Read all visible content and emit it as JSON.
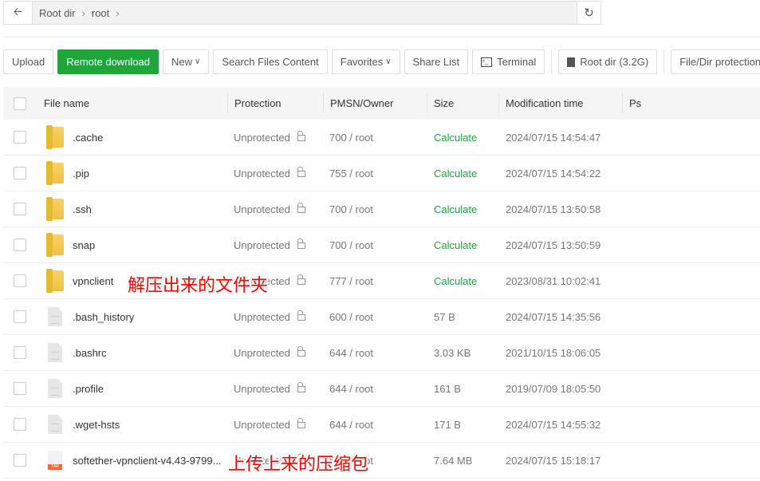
{
  "address": {
    "crumbs": [
      "Root dir",
      "root"
    ]
  },
  "toolbar": {
    "upload": "Upload",
    "remote_download": "Remote download",
    "new": "New",
    "search": "Search Files Content",
    "favorites": "Favorites",
    "share": "Share List",
    "terminal": "Terminal",
    "rootdir": "Root dir (3.2G)",
    "protection": "File/Dir protection"
  },
  "headers": {
    "name": "File name",
    "protection": "Protection",
    "pmsn": "PMSN/Owner",
    "size": "Size",
    "mtime": "Modification time",
    "ps": "Ps"
  },
  "rows": [
    {
      "type": "folder",
      "name": ".cache",
      "prot": "Unprotected",
      "pmsn": "700 / root",
      "size": "Calculate",
      "mtime": "2024/07/15 14:54:47"
    },
    {
      "type": "folder",
      "name": ".pip",
      "prot": "Unprotected",
      "pmsn": "755 / root",
      "size": "Calculate",
      "mtime": "2024/07/15 14:54:22"
    },
    {
      "type": "folder",
      "name": ".ssh",
      "prot": "Unprotected",
      "pmsn": "700 / root",
      "size": "Calculate",
      "mtime": "2024/07/15 13:50:58"
    },
    {
      "type": "folder",
      "name": "snap",
      "prot": "Unprotected",
      "pmsn": "700 / root",
      "size": "Calculate",
      "mtime": "2024/07/15 13:50:59"
    },
    {
      "type": "folder",
      "name": "vpnclient",
      "prot": "Unprotected",
      "pmsn": "777 / root",
      "size": "Calculate",
      "mtime": "2023/08/31 10:02:41"
    },
    {
      "type": "file",
      "name": ".bash_history",
      "prot": "Unprotected",
      "pmsn": "600 / root",
      "size": "57 B",
      "mtime": "2024/07/15 14:35:56"
    },
    {
      "type": "file",
      "name": ".bashrc",
      "prot": "Unprotected",
      "pmsn": "644 / root",
      "size": "3.03 KB",
      "mtime": "2021/10/15 18:06:05"
    },
    {
      "type": "file",
      "name": ".profile",
      "prot": "Unprotected",
      "pmsn": "644 / root",
      "size": "161 B",
      "mtime": "2019/07/09 18:05:50"
    },
    {
      "type": "file",
      "name": ".wget-hsts",
      "prot": "Unprotected",
      "pmsn": "644 / root",
      "size": "171 B",
      "mtime": "2024/07/15 14:55:32"
    },
    {
      "type": "tar",
      "name": "softether-vpnclient-v4.43-9799...",
      "prot": "Unprotected",
      "pmsn": "644 / root",
      "size": "7.64 MB",
      "mtime": "2024/07/15 15:18:17"
    }
  ],
  "annotations": {
    "folder": "解压出来的文件夹",
    "archive": "上传上来的压缩包"
  }
}
